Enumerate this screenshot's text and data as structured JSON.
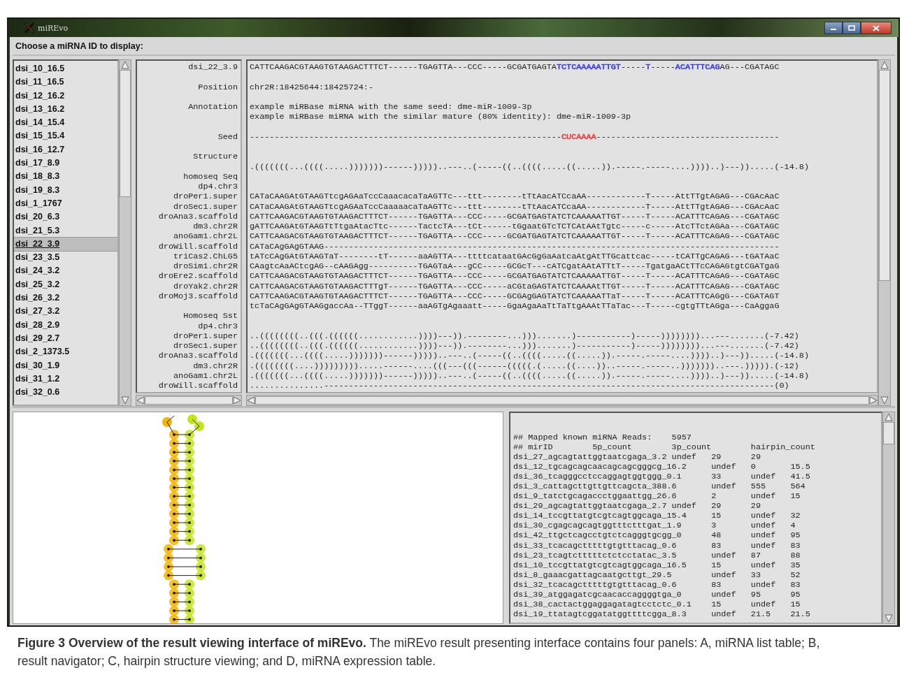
{
  "window": {
    "title": "miREvo"
  },
  "prompt": "Choose a miRNA ID to display:",
  "mirna_list": [
    {
      "label": "dsi_10_16.5",
      "selected": false
    },
    {
      "label": "dsi_11_16.5",
      "selected": false
    },
    {
      "label": "dsi_12_16.2",
      "selected": false
    },
    {
      "label": "dsi_13_16.2",
      "selected": false
    },
    {
      "label": "dsi_14_15.4",
      "selected": false
    },
    {
      "label": "dsi_15_15.4",
      "selected": false
    },
    {
      "label": "dsi_16_12.7",
      "selected": false
    },
    {
      "label": "dsi_17_8.9",
      "selected": false
    },
    {
      "label": "dsi_18_8.3",
      "selected": false
    },
    {
      "label": "dsi_19_8.3",
      "selected": false
    },
    {
      "label": "dsi_1_1767",
      "selected": false
    },
    {
      "label": "dsi_20_6.3",
      "selected": false
    },
    {
      "label": "dsi_21_5.3",
      "selected": false
    },
    {
      "label": "dsi_22_3.9",
      "selected": true
    },
    {
      "label": "dsi_23_3.5",
      "selected": false
    },
    {
      "label": "dsi_24_3.2",
      "selected": false
    },
    {
      "label": "dsi_25_3.2",
      "selected": false
    },
    {
      "label": "dsi_26_3.2",
      "selected": false
    },
    {
      "label": "dsi_27_3.2",
      "selected": false
    },
    {
      "label": "dsi_28_2.9",
      "selected": false
    },
    {
      "label": "dsi_29_2.7",
      "selected": false
    },
    {
      "label": "dsi_2_1373.5",
      "selected": false
    },
    {
      "label": "dsi_30_1.9",
      "selected": false
    },
    {
      "label": "dsi_31_1.2",
      "selected": false
    },
    {
      "label": "dsi_32_0.6",
      "selected": false
    }
  ],
  "navigator": {
    "rows": [
      {
        "kind": "entry",
        "label": "dsi_22_3.9",
        "segments": [
          {
            "text": "CATTCAAGACGTAAGTGTAAGACTTTCT------TGAGTTA---CCC-----GCGATGAGTA"
          },
          {
            "text": "TCTCAAAAATTGT",
            "color": "#3333ee"
          },
          {
            "text": "-----"
          },
          {
            "text": "T",
            "color": "#3333ee"
          },
          {
            "text": "-----"
          },
          {
            "text": "ACATTTCAG",
            "color": "#3333ee"
          },
          {
            "text": "AG---CGATAGC"
          }
        ]
      },
      {
        "kind": "blank"
      },
      {
        "kind": "entry",
        "label": "Position",
        "text": "chr2R:18425644:18425724:-"
      },
      {
        "kind": "blank"
      },
      {
        "kind": "entry",
        "label": "Annotation",
        "text": "example miRBase miRNA with the same seed: dme-miR-1009-3p"
      },
      {
        "kind": "entry",
        "text": "example miRBase miRNA with the similar mature (80% identity): dme-miR-1009-3p"
      },
      {
        "kind": "blank"
      },
      {
        "kind": "entry",
        "label": "Seed",
        "segments": [
          {
            "text": "---------------------------------------------------------------"
          },
          {
            "text": "CUCAAAA",
            "color": "#ee3333"
          },
          {
            "text": "-------------------------------------"
          }
        ]
      },
      {
        "kind": "blank"
      },
      {
        "kind": "entry",
        "label": "Structure"
      },
      {
        "kind": "entry",
        "text": ".(((((((...((((.....)))))))------)))))..---..(-----((..((((.....((.....)).-----.-----....))))..)---)).....(-14.8)"
      },
      {
        "kind": "entry",
        "label": "homoseq Seq"
      },
      {
        "kind": "entry",
        "label": "dp4.chr3"
      },
      {
        "kind": "entry",
        "label": "droPer1.super",
        "text": "CATaCAAGAtGTAAGTtcgAGAaTccCaaacacaTaAGTTc---ttt--------tTtAacATCcaAA------------T-----AttTTgtAGAG---CGAcAaC"
      },
      {
        "kind": "entry",
        "label": "droSec1.super",
        "text": "CATaCAAGAtGTAAGTtcgAGAaTccCaaaaacaTaAGTTc---ttt--------tTtAacATCcaAA------------T-----AttTTgtAGAG---CGAcAaC"
      },
      {
        "kind": "entry",
        "label": "droAna3.scaffold",
        "text": "CATTCAAGACGTAAGTGTAAGACTTTCT------TGAGTTA---CCC-----GCGATGAGTATCTCAAAAATTGT-----T-----ACATTTCAGAG---CGATAGC"
      },
      {
        "kind": "entry",
        "label": "dm3.chr2R",
        "text": "gATTCAAGAtGTAAGTtTtgaAtacTtc------TactcTA---tCt------tGgaatGTcTCTCAtAAtTgtc-----c-----AtcTTctAGAa---CGATAGC"
      },
      {
        "kind": "entry",
        "label": "anoGam1.chr2L",
        "text": "CATTCAAGACGTAAGTGTAAGACTTTCT------TGAGTTA---CCC-----GCGATGAGTATCTCAAAAATTGT-----T-----ACATTTCAGAG---CGATAGC"
      },
      {
        "kind": "entry",
        "label": "droWill.scaffold",
        "text": "CATaCAgGAgGTAAG--------------------------------------------------------------------------------------------"
      },
      {
        "kind": "entry",
        "label": "triCas2.ChLG5",
        "text": "tATcCAgGAtGTAAGTaT--------tT------aaAGTTA---ttttcataatGAcGgGaAatcaAtgAtTTGcattcac-----tCATTgCAGAG---tGATAaC"
      },
      {
        "kind": "entry",
        "label": "droSim1.chr2R",
        "text": "CAagtcAaACtcgAG--cAAGAgg----------TGAGTaA---gCC-----GCGcT---cATCgatAAtATTtT-----TgatgaACtTTcCAGAGtgtCGATgaG"
      },
      {
        "kind": "entry",
        "label": "droEre2.scaffold",
        "text": "CATTCAAGACGTAAGTGTAAGACTTTCT------TGAGTTA---CCC-----GCGATGAGTATCTCAAAAATTGT-----T-----ACATTTCAGAG---CGATAGC"
      },
      {
        "kind": "entry",
        "label": "droYak2.chr2R",
        "text": "CATTCAAGACGTAAGTGTAAGACTTTgT------TGAGTTA---CCC-----aCGtaGAGTATCTCAAAAtTTGT-----T-----ACATTTCAGAG---CGATAGC"
      },
      {
        "kind": "entry",
        "label": "droMoj3.scaffold",
        "text": "CATTCAAGACGTAAGTGTAAGACTTTCT------TGAGTTA---CCC-----GCGAgGAGTATCTCAAAAATTaT-----T-----ACATTTCAGgG---CGATAGT"
      },
      {
        "kind": "entry",
        "text": "tcTaCAgGAgGTAAGgaccAa--TTggT------aaAGTgAgaaatt-----GgaAgaAaTtTaTtgAAAtTTaTac---T-----cgtgTTtAGga---CaAggaG"
      },
      {
        "kind": "entry",
        "label": "Homoseq Sst"
      },
      {
        "kind": "entry",
        "label": "dp4.chr3"
      },
      {
        "kind": "entry",
        "label": "droPer1.super",
        "text": "..((((((((..(((.((((((............))))---)).--------...))).......)-----------)-----))))))))...---.......(-7.42)"
      },
      {
        "kind": "entry",
        "label": "droSec1.super",
        "text": "..((((((((..(((.((((((............))))---)).--------...))).......)-----------)-----))))))))...---.......(-7.42)"
      },
      {
        "kind": "entry",
        "label": "droAna3.scaffold",
        "text": ".(((((((...((((.....)))))))------)))))..---..(-----((..((((.....((.....)).-----.-----....))))..)---)).....(-14.8)"
      },
      {
        "kind": "entry",
        "label": "dm3.chr2R",
        "text": ".((((((((....))))))))).....------....(((---(((------(((((.(.....((....))..-----.-----..)))))))..---.))))).(-12)"
      },
      {
        "kind": "entry",
        "label": "anoGam1.chr2L",
        "text": ".(((((((...((((.....)))))))------)))))..---..(-----((..((((.....((.....)).-----.-----....))))..)---)).....(-14.8)"
      },
      {
        "kind": "entry",
        "label": "droWill.scaffold",
        "text": "...............-------------------------------------------------------------------------------------------(0)"
      }
    ]
  },
  "expression_table": {
    "summary": [
      "## Mapped known miRNA Reads:",
      "5957"
    ],
    "header": "## mirID\t5p_count\t3p_count\thairpin_count",
    "rows": [
      [
        "dsi_27_agcagtattggtaatcgaga_3.2",
        "undef",
        "29",
        "29"
      ],
      [
        "dsi_12_tgcagcagcaacagcagcgggcg_16.2",
        "undef",
        "0",
        "15.5"
      ],
      [
        "dsi_36_tcagggcctccaggagtggtggg_0.1",
        "33",
        "undef",
        "41.5"
      ],
      [
        "dsi_3_cattagcttgttgttcagcta_388.6",
        "undef",
        "555",
        "564"
      ],
      [
        "dsi_9_tatctgcagaccctggaattgg_26.6",
        "2",
        "undef",
        "15"
      ],
      [
        "dsi_29_agcagtattggtaatcgaga_2.7",
        "undef",
        "29",
        "29"
      ],
      [
        "dsi_14_tccgttatgtcgtcagtggcaga_15.4",
        "15",
        "undef",
        "32"
      ],
      [
        "dsi_30_cgagcagcagtggtttctttgat_1.9",
        "3",
        "undef",
        "4"
      ],
      [
        "dsi_42_ttgctcagcctgtctcagggtgcgg_0",
        "48",
        "undef",
        "95"
      ],
      [
        "dsi_33_tcacagctttttgtgtttacag_0.6",
        "83",
        "undef",
        "83"
      ],
      [
        "dsi_23_tcagtctttttctctcctatac_3.5",
        "undef",
        "87",
        "88"
      ],
      [
        "dsi_10_tccgttatgtcgtcagtggcaga_16.5",
        "15",
        "undef",
        "35"
      ],
      [
        "dsi_8_gaaacgattagcaatgcttgt_29.5",
        "undef",
        "33",
        "52"
      ],
      [
        "dsi_32_tcacagctttttgtgtttacag_0.6",
        "83",
        "undef",
        "83"
      ],
      [
        "dsi_39_atggagatcgcaacaccaggggtga_0",
        "undef",
        "95",
        "95"
      ],
      [
        "dsi_38_cactactggaggagatagtcctctc_0.1",
        "15",
        "undef",
        "15"
      ],
      [
        "dsi_19_ttatagtcggatatggttttcgga_8.3",
        "undef",
        "21.5",
        "21.5"
      ]
    ]
  },
  "caption": "**Figure 3 Overview of the result viewing interface of miREvo.** The miREvo result presenting interface contains four panels: A, miRNA list table; B, result navigator; C, hairpin structure viewing; and D, miRNA expression table."
}
